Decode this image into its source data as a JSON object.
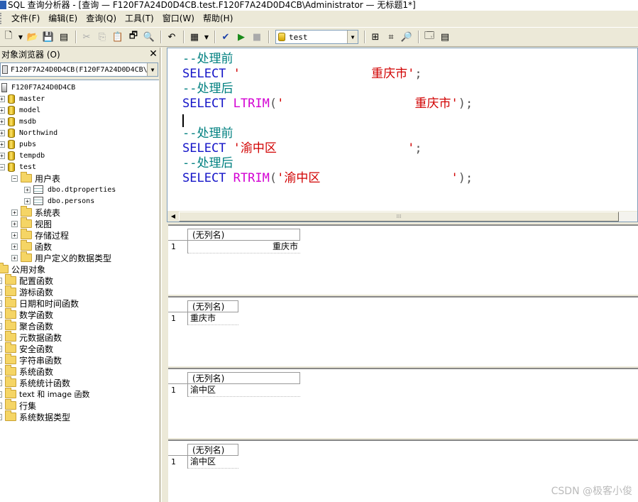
{
  "window": {
    "title": "SQL 查询分析器 - [查询 — F120F7A24D0D4CB.test.F120F7A24D0D4CB\\Administrator — 无标题1*]"
  },
  "menu": {
    "items": [
      "文件(F)",
      "编辑(E)",
      "查询(Q)",
      "工具(T)",
      "窗口(W)",
      "帮助(H)"
    ]
  },
  "toolbar": {
    "database": "test"
  },
  "object_browser": {
    "title": "对象浏览器 (O)",
    "server_combo": "F120F7A24D0D4CB(F120F7A24D0D4CB\\",
    "server": "F120F7A24D0D4CB",
    "databases": [
      "master",
      "model",
      "msdb",
      "Northwind",
      "pubs",
      "tempdb",
      "test"
    ],
    "test_children": {
      "user_tables": "用户表",
      "tables": [
        "dbo.dtproperties",
        "dbo.persons"
      ],
      "folders": [
        "系统表",
        "视图",
        "存储过程",
        "函数",
        "用户定义的数据类型"
      ]
    },
    "common_objects": "公用对象",
    "common_folders": [
      "配置函数",
      "游标函数",
      "日期和时间函数",
      "数学函数",
      "聚合函数",
      "元数据函数",
      "安全函数",
      "字符串函数",
      "系统函数",
      "系统统计函数",
      "text 和 image 函数",
      "行集",
      "系统数据类型"
    ]
  },
  "editor": {
    "lines": {
      "c1": "--处理前",
      "kw1": "SELECT ",
      "s1": "'                  重庆市'",
      "e1": ";",
      "c2": "--处理后",
      "kw2": "SELECT ",
      "f2": "LTRIM",
      "p2a": "(",
      "s2": "'                  重庆市'",
      "p2b": ");",
      "c3": "--处理前",
      "kw3": "SELECT ",
      "s3": "'渝中区                  '",
      "e3": ";",
      "c4": "--处理后",
      "kw4": "SELECT ",
      "f4": "RTRIM",
      "p4a": "(",
      "s4": "'渝中区                  '",
      "p4b": ");"
    }
  },
  "results": [
    {
      "column": "(无列名)",
      "row_number": "1",
      "value": "重庆市"
    },
    {
      "column": "(无列名)",
      "row_number": "1",
      "value": "重庆市"
    },
    {
      "column": "(无列名)",
      "row_number": "1",
      "value": "渝中区"
    },
    {
      "column": "(无列名)",
      "row_number": "1",
      "value": "渝中区"
    }
  ],
  "watermark": "CSDN @极客小俊"
}
